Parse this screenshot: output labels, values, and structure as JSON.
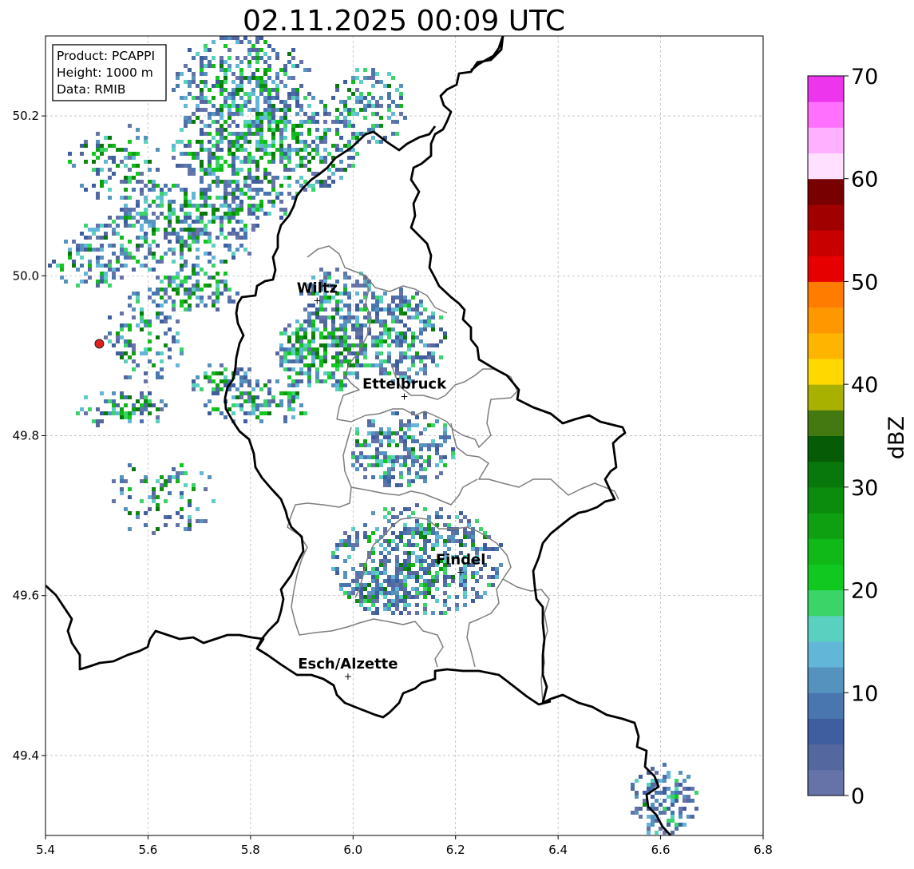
{
  "title": "02.11.2025 00:09 UTC",
  "info_box": {
    "product": "Product: PCAPPI",
    "height": "Height: 1000 m",
    "data": "Data: RMIB"
  },
  "map": {
    "x_ticks": [
      "5.4",
      "5.6",
      "5.8",
      "6.0",
      "6.2",
      "6.4",
      "6.6",
      "6.8"
    ],
    "y_ticks": [
      "49.4",
      "49.6",
      "49.8",
      "50.0",
      "50.2"
    ],
    "lon_range": [
      5.4,
      6.8
    ],
    "lat_range": [
      49.3,
      50.3
    ],
    "gridlines": true
  },
  "cities": [
    {
      "name": "Wiltz",
      "lon": 5.93,
      "lat": 49.97
    },
    {
      "name": "Ettelbruck",
      "lon": 6.1,
      "lat": 49.85
    },
    {
      "name": "Findel",
      "lon": 6.21,
      "lat": 49.63
    },
    {
      "name": "Esch/Alzette",
      "lon": 5.99,
      "lat": 49.5
    }
  ],
  "radar_site": {
    "lon": 5.505,
    "lat": 49.915,
    "color": "#e02020"
  },
  "colorbar": {
    "label": "dBZ",
    "ticks": [
      "0",
      "10",
      "20",
      "30",
      "40",
      "50",
      "60",
      "70"
    ],
    "range": [
      0,
      70
    ],
    "colors": [
      "#6573a8",
      "#54679e",
      "#3f5ea0",
      "#4a76b0",
      "#5592be",
      "#62b7d8",
      "#5ad0c0",
      "#3ad468",
      "#10c820",
      "#10b818",
      "#0ea010",
      "#0c8c0c",
      "#08780c",
      "#065c06",
      "#447810",
      "#a8b000",
      "#ffd800",
      "#ffb400",
      "#ff9800",
      "#ff7c00",
      "#e60000",
      "#c80000",
      "#a00000",
      "#780000",
      "#ffe0ff",
      "#ffb0ff",
      "#ff70ff",
      "#ee35ee"
    ]
  }
}
